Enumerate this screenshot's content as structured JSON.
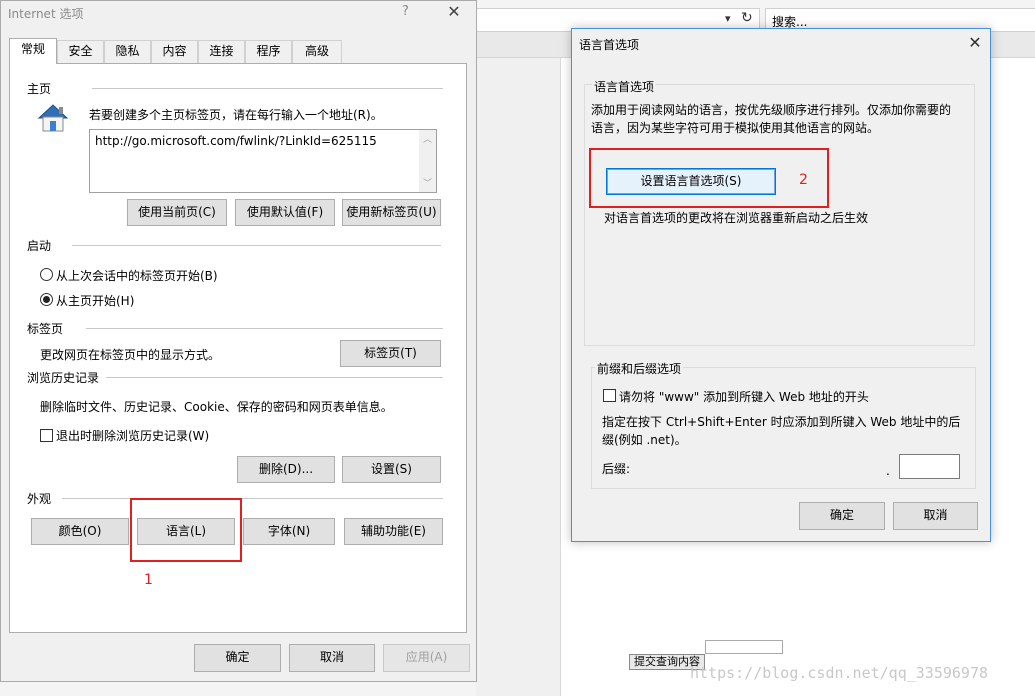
{
  "background": {
    "search_placeholder": "搜索...",
    "submit_button": "提交查询内容",
    "watermark": "https://blog.csdn.net/qq_33596978"
  },
  "internet_options": {
    "title": "Internet 选项",
    "help": "?",
    "tabs": [
      "常规",
      "安全",
      "隐私",
      "内容",
      "连接",
      "程序",
      "高级"
    ],
    "active_tab": "常规",
    "home": {
      "heading": "主页",
      "instruction": "若要创建多个主页标签页，请在每行输入一个地址(R)。",
      "url": "http://go.microsoft.com/fwlink/?LinkId=625115",
      "use_current": "使用当前页(C)",
      "use_default": "使用默认值(F)",
      "use_new_tab": "使用新标签页(U)"
    },
    "startup": {
      "heading": "启动",
      "option_last_session": "从上次会话中的标签页开始(B)",
      "option_home": "从主页开始(H)",
      "selected": "option_home"
    },
    "tabs_section": {
      "heading": "标签页",
      "description": "更改网页在标签页中的显示方式。",
      "button": "标签页(T)"
    },
    "history": {
      "heading": "浏览历史记录",
      "description": "删除临时文件、历史记录、Cookie、保存的密码和网页表单信息。",
      "delete_on_exit": "退出时删除浏览历史记录(W)",
      "delete_on_exit_checked": false,
      "delete_button": "删除(D)...",
      "settings_button": "设置(S)"
    },
    "appearance": {
      "heading": "外观",
      "colors": "颜色(O)",
      "languages": "语言(L)",
      "fonts": "字体(N)",
      "accessibility": "辅助功能(E)"
    },
    "annotation_1": "1",
    "ok": "确定",
    "cancel": "取消",
    "apply": "应用(A)"
  },
  "language_pref": {
    "title": "语言首选项",
    "group_title": "语言首选项",
    "description_line1": "添加用于阅读网站的语言，按优先级顺序进行排列。仅添加你需要的",
    "description_line2": "语言，因为某些字符可用于模拟使用其他语言的网站。",
    "set_button": "设置语言首选项(S)",
    "restart_note": "对语言首选项的更改将在浏览器重新启动之后生效",
    "annotation_2": "2",
    "prefix_group_title": "前缀和后缀选项",
    "no_www": "请勿将 \"www\" 添加到所键入 Web 地址的开头",
    "no_www_checked": false,
    "suffix_desc_line1": "指定在按下 Ctrl+Shift+Enter 时应添加到所键入 Web 地址中的后",
    "suffix_desc_line2": "缀(例如 .net)。",
    "suffix_label": "后缀:",
    "suffix_dot": ".",
    "ok": "确定",
    "cancel": "取消"
  }
}
